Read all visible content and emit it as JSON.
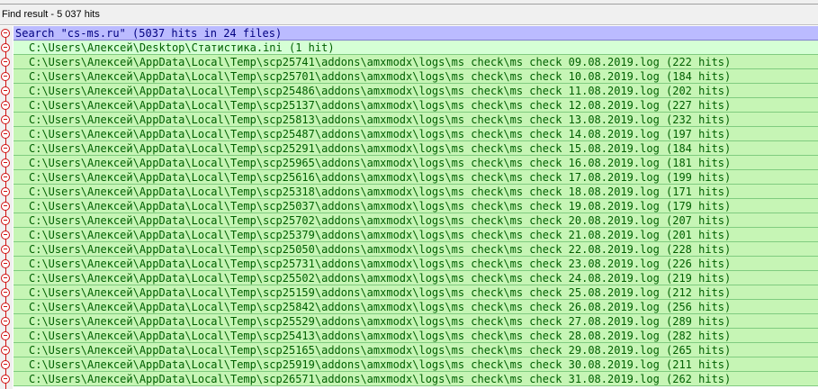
{
  "panel": {
    "title": "Find result - 5 037 hits"
  },
  "search": {
    "line": "Search \"cs-ms.ru\" (5037 hits in 24 files)"
  },
  "colors": {
    "search_bg": "#bbbbff",
    "file_bg": "#d5ffd5",
    "fold_marker": "#d01010",
    "file_text": "#006000",
    "search_text": "#000080"
  },
  "files": [
    "C:\\Users\\Алексей\\Desktop\\Статистика.ini (1 hit)",
    "C:\\Users\\Алексей\\AppData\\Local\\Temp\\scp25741\\addons\\amxmodx\\logs\\ms check\\ms check 09.08.2019.log (222 hits)",
    "C:\\Users\\Алексей\\AppData\\Local\\Temp\\scp25701\\addons\\amxmodx\\logs\\ms check\\ms check 10.08.2019.log (184 hits)",
    "C:\\Users\\Алексей\\AppData\\Local\\Temp\\scp25486\\addons\\amxmodx\\logs\\ms check\\ms check 11.08.2019.log (202 hits)",
    "C:\\Users\\Алексей\\AppData\\Local\\Temp\\scp25137\\addons\\amxmodx\\logs\\ms check\\ms check 12.08.2019.log (227 hits)",
    "C:\\Users\\Алексей\\AppData\\Local\\Temp\\scp25813\\addons\\amxmodx\\logs\\ms check\\ms check 13.08.2019.log (232 hits)",
    "C:\\Users\\Алексей\\AppData\\Local\\Temp\\scp25487\\addons\\amxmodx\\logs\\ms check\\ms check 14.08.2019.log (197 hits)",
    "C:\\Users\\Алексей\\AppData\\Local\\Temp\\scp25291\\addons\\amxmodx\\logs\\ms check\\ms check 15.08.2019.log (184 hits)",
    "C:\\Users\\Алексей\\AppData\\Local\\Temp\\scp25965\\addons\\amxmodx\\logs\\ms check\\ms check 16.08.2019.log (181 hits)",
    "C:\\Users\\Алексей\\AppData\\Local\\Temp\\scp25616\\addons\\amxmodx\\logs\\ms check\\ms check 17.08.2019.log (199 hits)",
    "C:\\Users\\Алексей\\AppData\\Local\\Temp\\scp25318\\addons\\amxmodx\\logs\\ms check\\ms check 18.08.2019.log (171 hits)",
    "C:\\Users\\Алексей\\AppData\\Local\\Temp\\scp25037\\addons\\amxmodx\\logs\\ms check\\ms check 19.08.2019.log (179 hits)",
    "C:\\Users\\Алексей\\AppData\\Local\\Temp\\scp25702\\addons\\amxmodx\\logs\\ms check\\ms check 20.08.2019.log (207 hits)",
    "C:\\Users\\Алексей\\AppData\\Local\\Temp\\scp25379\\addons\\amxmodx\\logs\\ms check\\ms check 21.08.2019.log (201 hits)",
    "C:\\Users\\Алексей\\AppData\\Local\\Temp\\scp25050\\addons\\amxmodx\\logs\\ms check\\ms check 22.08.2019.log (228 hits)",
    "C:\\Users\\Алексей\\AppData\\Local\\Temp\\scp25731\\addons\\amxmodx\\logs\\ms check\\ms check 23.08.2019.log (226 hits)",
    "C:\\Users\\Алексей\\AppData\\Local\\Temp\\scp25502\\addons\\amxmodx\\logs\\ms check\\ms check 24.08.2019.log (219 hits)",
    "C:\\Users\\Алексей\\AppData\\Local\\Temp\\scp25159\\addons\\amxmodx\\logs\\ms check\\ms check 25.08.2019.log (212 hits)",
    "C:\\Users\\Алексей\\AppData\\Local\\Temp\\scp25842\\addons\\amxmodx\\logs\\ms check\\ms check 26.08.2019.log (256 hits)",
    "C:\\Users\\Алексей\\AppData\\Local\\Temp\\scp25529\\addons\\amxmodx\\logs\\ms check\\ms check 27.08.2019.log (289 hits)",
    "C:\\Users\\Алексей\\AppData\\Local\\Temp\\scp25413\\addons\\amxmodx\\logs\\ms check\\ms check 28.08.2019.log (282 hits)",
    "C:\\Users\\Алексей\\AppData\\Local\\Temp\\scp25165\\addons\\amxmodx\\logs\\ms check\\ms check 29.08.2019.log (265 hits)",
    "C:\\Users\\Алексей\\AppData\\Local\\Temp\\scp25919\\addons\\amxmodx\\logs\\ms check\\ms check 30.08.2019.log (211 hits)",
    "C:\\Users\\Алексей\\AppData\\Local\\Temp\\scp26571\\addons\\amxmodx\\logs\\ms check\\ms check 31.08.2019.log (262 hits)"
  ]
}
